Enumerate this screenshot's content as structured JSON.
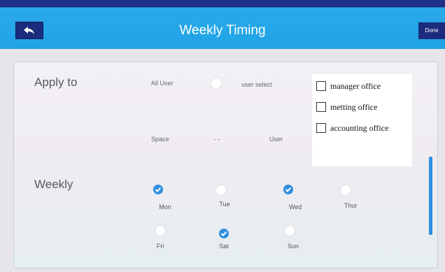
{
  "header": {
    "title": "Weekly Timing",
    "done_label": "Done"
  },
  "apply_to": {
    "label": "Apply to",
    "all_user_label": "All User",
    "user_select_label": "user select",
    "space_label": "Space",
    "range_separator": "- -",
    "user_label": "User",
    "offices": [
      {
        "label": "manager office",
        "checked": false
      },
      {
        "label": "metting office",
        "checked": false
      },
      {
        "label": "accounting office",
        "checked": false
      }
    ]
  },
  "weekly": {
    "label": "Weekly",
    "days": [
      {
        "label": "Mon",
        "checked": true
      },
      {
        "label": "Tue",
        "checked": false
      },
      {
        "label": "Wed",
        "checked": true
      },
      {
        "label": "Thur",
        "checked": false
      },
      {
        "label": "Fri",
        "checked": false
      },
      {
        "label": "Sat",
        "checked": true
      },
      {
        "label": "Sun",
        "checked": false
      }
    ]
  },
  "colors": {
    "header_bar": "#1fa3e6",
    "accent": "#2e8fe0",
    "button_dark": "#1b2c7e"
  },
  "icons": {
    "back": "back-arrow-icon",
    "check": "checkmark-icon"
  }
}
